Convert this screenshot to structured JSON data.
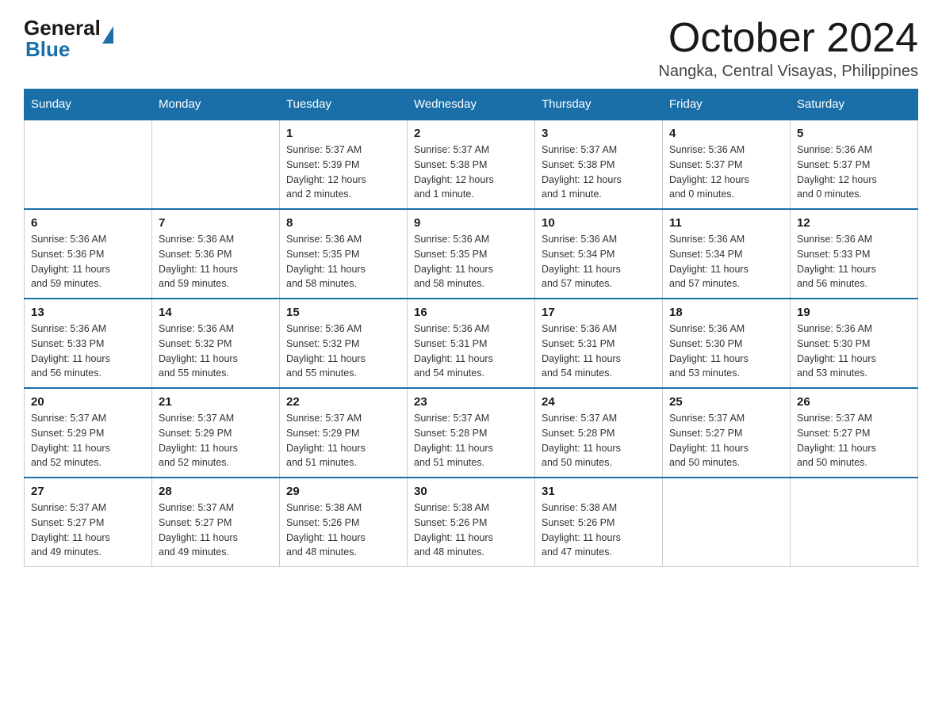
{
  "logo": {
    "text_general": "General",
    "text_blue": "Blue"
  },
  "header": {
    "month_title": "October 2024",
    "location": "Nangka, Central Visayas, Philippines"
  },
  "weekdays": [
    "Sunday",
    "Monday",
    "Tuesday",
    "Wednesday",
    "Thursday",
    "Friday",
    "Saturday"
  ],
  "weeks": [
    [
      {
        "day": "",
        "info": ""
      },
      {
        "day": "",
        "info": ""
      },
      {
        "day": "1",
        "info": "Sunrise: 5:37 AM\nSunset: 5:39 PM\nDaylight: 12 hours\nand 2 minutes."
      },
      {
        "day": "2",
        "info": "Sunrise: 5:37 AM\nSunset: 5:38 PM\nDaylight: 12 hours\nand 1 minute."
      },
      {
        "day": "3",
        "info": "Sunrise: 5:37 AM\nSunset: 5:38 PM\nDaylight: 12 hours\nand 1 minute."
      },
      {
        "day": "4",
        "info": "Sunrise: 5:36 AM\nSunset: 5:37 PM\nDaylight: 12 hours\nand 0 minutes."
      },
      {
        "day": "5",
        "info": "Sunrise: 5:36 AM\nSunset: 5:37 PM\nDaylight: 12 hours\nand 0 minutes."
      }
    ],
    [
      {
        "day": "6",
        "info": "Sunrise: 5:36 AM\nSunset: 5:36 PM\nDaylight: 11 hours\nand 59 minutes."
      },
      {
        "day": "7",
        "info": "Sunrise: 5:36 AM\nSunset: 5:36 PM\nDaylight: 11 hours\nand 59 minutes."
      },
      {
        "day": "8",
        "info": "Sunrise: 5:36 AM\nSunset: 5:35 PM\nDaylight: 11 hours\nand 58 minutes."
      },
      {
        "day": "9",
        "info": "Sunrise: 5:36 AM\nSunset: 5:35 PM\nDaylight: 11 hours\nand 58 minutes."
      },
      {
        "day": "10",
        "info": "Sunrise: 5:36 AM\nSunset: 5:34 PM\nDaylight: 11 hours\nand 57 minutes."
      },
      {
        "day": "11",
        "info": "Sunrise: 5:36 AM\nSunset: 5:34 PM\nDaylight: 11 hours\nand 57 minutes."
      },
      {
        "day": "12",
        "info": "Sunrise: 5:36 AM\nSunset: 5:33 PM\nDaylight: 11 hours\nand 56 minutes."
      }
    ],
    [
      {
        "day": "13",
        "info": "Sunrise: 5:36 AM\nSunset: 5:33 PM\nDaylight: 11 hours\nand 56 minutes."
      },
      {
        "day": "14",
        "info": "Sunrise: 5:36 AM\nSunset: 5:32 PM\nDaylight: 11 hours\nand 55 minutes."
      },
      {
        "day": "15",
        "info": "Sunrise: 5:36 AM\nSunset: 5:32 PM\nDaylight: 11 hours\nand 55 minutes."
      },
      {
        "day": "16",
        "info": "Sunrise: 5:36 AM\nSunset: 5:31 PM\nDaylight: 11 hours\nand 54 minutes."
      },
      {
        "day": "17",
        "info": "Sunrise: 5:36 AM\nSunset: 5:31 PM\nDaylight: 11 hours\nand 54 minutes."
      },
      {
        "day": "18",
        "info": "Sunrise: 5:36 AM\nSunset: 5:30 PM\nDaylight: 11 hours\nand 53 minutes."
      },
      {
        "day": "19",
        "info": "Sunrise: 5:36 AM\nSunset: 5:30 PM\nDaylight: 11 hours\nand 53 minutes."
      }
    ],
    [
      {
        "day": "20",
        "info": "Sunrise: 5:37 AM\nSunset: 5:29 PM\nDaylight: 11 hours\nand 52 minutes."
      },
      {
        "day": "21",
        "info": "Sunrise: 5:37 AM\nSunset: 5:29 PM\nDaylight: 11 hours\nand 52 minutes."
      },
      {
        "day": "22",
        "info": "Sunrise: 5:37 AM\nSunset: 5:29 PM\nDaylight: 11 hours\nand 51 minutes."
      },
      {
        "day": "23",
        "info": "Sunrise: 5:37 AM\nSunset: 5:28 PM\nDaylight: 11 hours\nand 51 minutes."
      },
      {
        "day": "24",
        "info": "Sunrise: 5:37 AM\nSunset: 5:28 PM\nDaylight: 11 hours\nand 50 minutes."
      },
      {
        "day": "25",
        "info": "Sunrise: 5:37 AM\nSunset: 5:27 PM\nDaylight: 11 hours\nand 50 minutes."
      },
      {
        "day": "26",
        "info": "Sunrise: 5:37 AM\nSunset: 5:27 PM\nDaylight: 11 hours\nand 50 minutes."
      }
    ],
    [
      {
        "day": "27",
        "info": "Sunrise: 5:37 AM\nSunset: 5:27 PM\nDaylight: 11 hours\nand 49 minutes."
      },
      {
        "day": "28",
        "info": "Sunrise: 5:37 AM\nSunset: 5:27 PM\nDaylight: 11 hours\nand 49 minutes."
      },
      {
        "day": "29",
        "info": "Sunrise: 5:38 AM\nSunset: 5:26 PM\nDaylight: 11 hours\nand 48 minutes."
      },
      {
        "day": "30",
        "info": "Sunrise: 5:38 AM\nSunset: 5:26 PM\nDaylight: 11 hours\nand 48 minutes."
      },
      {
        "day": "31",
        "info": "Sunrise: 5:38 AM\nSunset: 5:26 PM\nDaylight: 11 hours\nand 47 minutes."
      },
      {
        "day": "",
        "info": ""
      },
      {
        "day": "",
        "info": ""
      }
    ]
  ]
}
